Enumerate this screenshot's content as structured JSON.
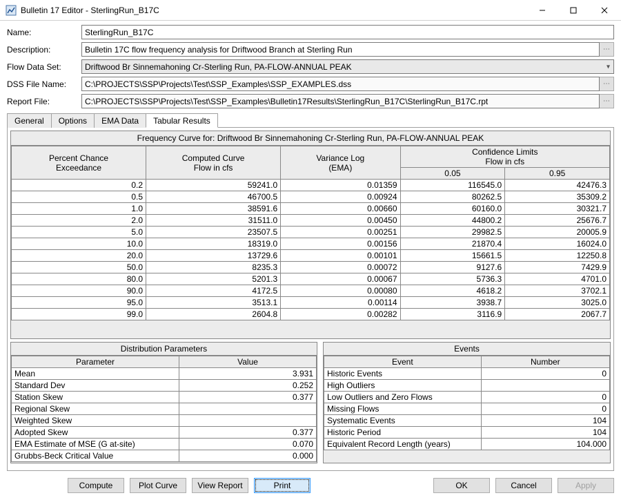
{
  "window": {
    "title": "Bulletin 17 Editor - SterlingRun_B17C"
  },
  "form": {
    "name_label": "Name:",
    "name_value": "SterlingRun_B17C",
    "desc_label": "Description:",
    "desc_value": "Bulletin 17C flow frequency analysis for Driftwood Branch at Sterling Run",
    "flow_label": "Flow Data Set:",
    "flow_value": "Driftwood Br Sinnemahoning Cr-Sterling Run, PA-FLOW-ANNUAL PEAK",
    "dss_label": "DSS File Name:",
    "dss_value": "C:\\PROJECTS\\SSP\\Projects\\Test\\SSP_Examples\\SSP_EXAMPLES.dss",
    "report_label": "Report File:",
    "report_value": "C:\\PROJECTS\\SSP\\Projects\\Test\\SSP_Examples\\Bulletin17Results\\SterlingRun_B17C\\SterlingRun_B17C.rpt"
  },
  "tabs": {
    "general": "General",
    "options": "Options",
    "ema": "EMA Data",
    "results": "Tabular Results"
  },
  "freq_table": {
    "title": "Frequency Curve for: Driftwood Br Sinnemahoning Cr-Sterling Run, PA-FLOW-ANNUAL PEAK",
    "headers": {
      "pct": [
        "Percent Chance",
        "Exceedance"
      ],
      "curve": [
        "Computed Curve",
        "Flow in cfs"
      ],
      "var": [
        "Variance Log",
        "(EMA)"
      ],
      "conf": [
        "Confidence Limits",
        "Flow in cfs"
      ],
      "c05": "0.05",
      "c95": "0.95"
    },
    "rows": [
      {
        "pct": "0.2",
        "curve": "59241.0",
        "var": "0.01359",
        "c05": "116545.0",
        "c95": "42476.3"
      },
      {
        "pct": "0.5",
        "curve": "46700.5",
        "var": "0.00924",
        "c05": "80262.5",
        "c95": "35309.2"
      },
      {
        "pct": "1.0",
        "curve": "38591.6",
        "var": "0.00660",
        "c05": "60160.0",
        "c95": "30321.7"
      },
      {
        "pct": "2.0",
        "curve": "31511.0",
        "var": "0.00450",
        "c05": "44800.2",
        "c95": "25676.7"
      },
      {
        "pct": "5.0",
        "curve": "23507.5",
        "var": "0.00251",
        "c05": "29982.5",
        "c95": "20005.9"
      },
      {
        "pct": "10.0",
        "curve": "18319.0",
        "var": "0.00156",
        "c05": "21870.4",
        "c95": "16024.0"
      },
      {
        "pct": "20.0",
        "curve": "13729.6",
        "var": "0.00101",
        "c05": "15661.5",
        "c95": "12250.8"
      },
      {
        "pct": "50.0",
        "curve": "8235.3",
        "var": "0.00072",
        "c05": "9127.6",
        "c95": "7429.9"
      },
      {
        "pct": "80.0",
        "curve": "5201.3",
        "var": "0.00067",
        "c05": "5736.3",
        "c95": "4701.0"
      },
      {
        "pct": "90.0",
        "curve": "4172.5",
        "var": "0.00080",
        "c05": "4618.2",
        "c95": "3702.1"
      },
      {
        "pct": "95.0",
        "curve": "3513.1",
        "var": "0.00114",
        "c05": "3938.7",
        "c95": "3025.0"
      },
      {
        "pct": "99.0",
        "curve": "2604.8",
        "var": "0.00282",
        "c05": "3116.9",
        "c95": "2067.7"
      }
    ]
  },
  "dist_table": {
    "title": "Distribution Parameters",
    "h1": "Parameter",
    "h2": "Value",
    "rows": [
      {
        "p": "Mean",
        "v": "3.931"
      },
      {
        "p": "Standard Dev",
        "v": "0.252"
      },
      {
        "p": "Station Skew",
        "v": "0.377"
      },
      {
        "p": "Regional Skew",
        "v": ""
      },
      {
        "p": "Weighted Skew",
        "v": ""
      },
      {
        "p": "Adopted Skew",
        "v": "0.377"
      },
      {
        "p": "EMA Estimate of MSE (G at-site)",
        "v": "0.070"
      },
      {
        "p": "Grubbs-Beck Critical Value",
        "v": "0.000"
      }
    ]
  },
  "events_table": {
    "title": "Events",
    "h1": "Event",
    "h2": "Number",
    "rows": [
      {
        "e": "Historic Events",
        "n": "0"
      },
      {
        "e": "High Outliers",
        "n": ""
      },
      {
        "e": "Low Outliers and Zero Flows",
        "n": "0"
      },
      {
        "e": "Missing Flows",
        "n": "0"
      },
      {
        "e": "Systematic Events",
        "n": "104"
      },
      {
        "e": "Historic Period",
        "n": "104"
      },
      {
        "e": "Equivalent Record Length (years)",
        "n": "104.000"
      }
    ]
  },
  "buttons": {
    "compute": "Compute",
    "plot": "Plot Curve",
    "view": "View Report",
    "print": "Print",
    "ok": "OK",
    "cancel": "Cancel",
    "apply": "Apply"
  }
}
